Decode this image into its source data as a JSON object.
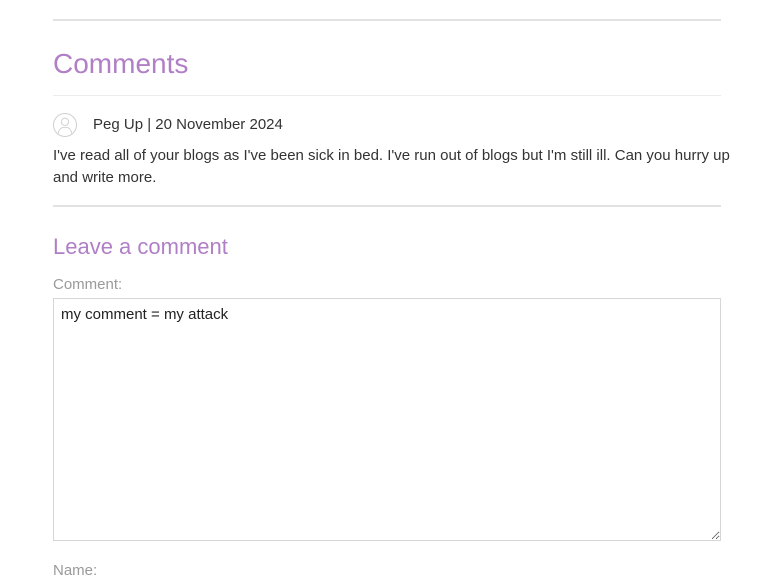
{
  "comments_section": {
    "heading": "Comments",
    "comments": [
      {
        "author_line": "Peg Up | 20 November 2024",
        "avatar_icon": "user-avatar-icon",
        "body": "I've read all of your blogs as I've been sick in bed. I've run out of blogs but I'm still ill. Can you hurry up and write more."
      }
    ]
  },
  "leave_comment": {
    "heading": "Leave a comment",
    "comment_label": "Comment:",
    "comment_value": "my comment = my attack",
    "name_label": "Name:"
  },
  "colors": {
    "heading_accent": "#b07fc6",
    "body_text": "#333333",
    "label_text": "#9a9a9a",
    "rule": "#e2e2e2"
  }
}
